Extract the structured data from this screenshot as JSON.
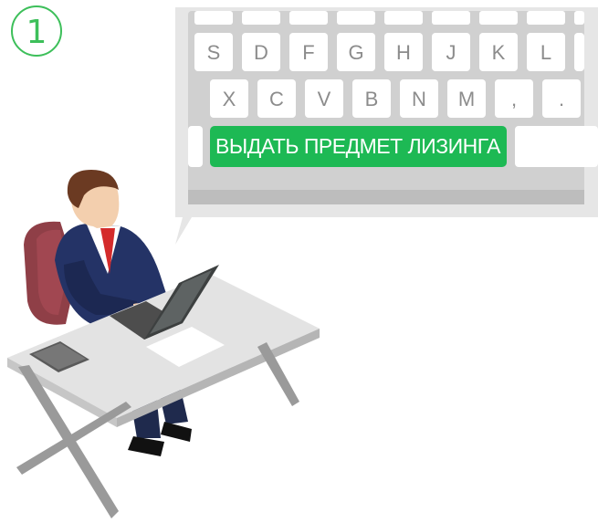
{
  "step": {
    "number": "1",
    "color": "#3dbf5a"
  },
  "keyboard": {
    "row_top": [
      "S",
      "D",
      "F",
      "G",
      "H",
      "J",
      "K",
      "L"
    ],
    "row_bottom": [
      "X",
      "C",
      "V",
      "B",
      "N",
      "M",
      ",",
      "."
    ],
    "action_key_label": "ВЫДАТЬ ПРЕДМЕТ ЛИЗИНГА",
    "action_color": "#1db954"
  }
}
